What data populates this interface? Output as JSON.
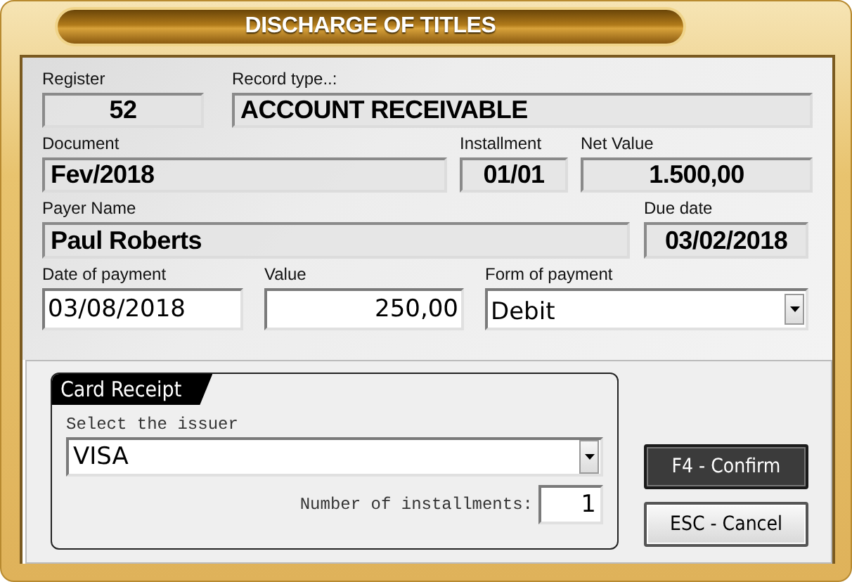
{
  "window": {
    "title": "DISCHARGE OF TITLES"
  },
  "rows": [
    [
      {
        "label": "Register",
        "value": "52",
        "kind": "readonly"
      },
      {
        "label": "Record type..:",
        "value": "ACCOUNT RECEIVABLE",
        "kind": "readonly"
      }
    ],
    [
      {
        "label": "Document",
        "value": "Fev/2018",
        "kind": "readonly"
      },
      {
        "label": "Installment",
        "value": "01/01",
        "kind": "readonly"
      },
      {
        "label": "Net Value",
        "value": "1.500,00",
        "kind": "readonly"
      }
    ],
    [
      {
        "label": "Payer Name",
        "value": "Paul Roberts",
        "kind": "readonly"
      },
      {
        "label": "Due date",
        "value": "03/02/2018",
        "kind": "readonly"
      }
    ],
    [
      {
        "label": "Date of payment",
        "value": "03/08/2018",
        "kind": "input"
      },
      {
        "label": "Value",
        "value": "250,00",
        "kind": "input"
      },
      {
        "label": "Form of payment",
        "value": "Debit",
        "kind": "select"
      }
    ]
  ],
  "card_receipt": {
    "title": "Card Receipt",
    "issuer_label": "Select the issuer",
    "issuer": "VISA",
    "installments_label": "Number of installments:",
    "installments": "1"
  },
  "buttons": [
    {
      "label": "F4 - Confirm",
      "kind": "primary"
    },
    {
      "label": "ESC - Cancel",
      "kind": "secondary"
    }
  ]
}
